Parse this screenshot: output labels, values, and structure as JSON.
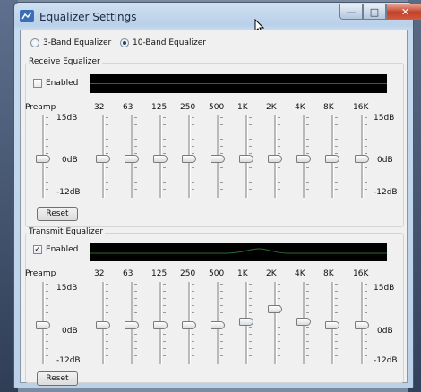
{
  "window": {
    "title": "Equalizer Settings"
  },
  "mode": {
    "options": [
      "3-Band Equalizer",
      "10-Band Equalizer"
    ],
    "selected": "10-Band Equalizer"
  },
  "sections": [
    {
      "label": "Receive Equalizer",
      "enabled_label": "Enabled",
      "enabled": false,
      "scale": {
        "top": "15dB",
        "mid": "0dB",
        "bottom": "-12dB"
      },
      "bands": [
        {
          "label": "Preamp",
          "level": 0
        },
        {
          "label": "32",
          "level": 0
        },
        {
          "label": "63",
          "level": 0
        },
        {
          "label": "125",
          "level": 0
        },
        {
          "label": "250",
          "level": 0
        },
        {
          "label": "500",
          "level": 0
        },
        {
          "label": "1K",
          "level": 0
        },
        {
          "label": "2K",
          "level": 0
        },
        {
          "label": "4K",
          "level": 0
        },
        {
          "label": "8K",
          "level": 0
        },
        {
          "label": "16K",
          "level": 0
        }
      ],
      "reset_label": "Reset"
    },
    {
      "label": "Transmit Equalizer",
      "enabled_label": "Enabled",
      "enabled": true,
      "scale": {
        "top": "15dB",
        "mid": "0dB",
        "bottom": "-12dB"
      },
      "bands": [
        {
          "label": "Preamp",
          "level": 0
        },
        {
          "label": "32",
          "level": 0
        },
        {
          "label": "63",
          "level": 0
        },
        {
          "label": "125",
          "level": 0
        },
        {
          "label": "250",
          "level": 0
        },
        {
          "label": "500",
          "level": 0
        },
        {
          "label": "1K",
          "level": 1
        },
        {
          "label": "2K",
          "level": 4
        },
        {
          "label": "4K",
          "level": 1
        },
        {
          "label": "8K",
          "level": 0
        },
        {
          "label": "16K",
          "level": 0
        }
      ],
      "reset_label": "Reset"
    }
  ],
  "colors": {
    "graph_bg": "#000000",
    "graph_curve": "#2b6a2b",
    "titlebar": "#c3d6ec"
  },
  "icons": [
    "app-icon",
    "minimize-icon",
    "maximize-icon",
    "close-icon",
    "mouse-cursor-icon"
  ]
}
